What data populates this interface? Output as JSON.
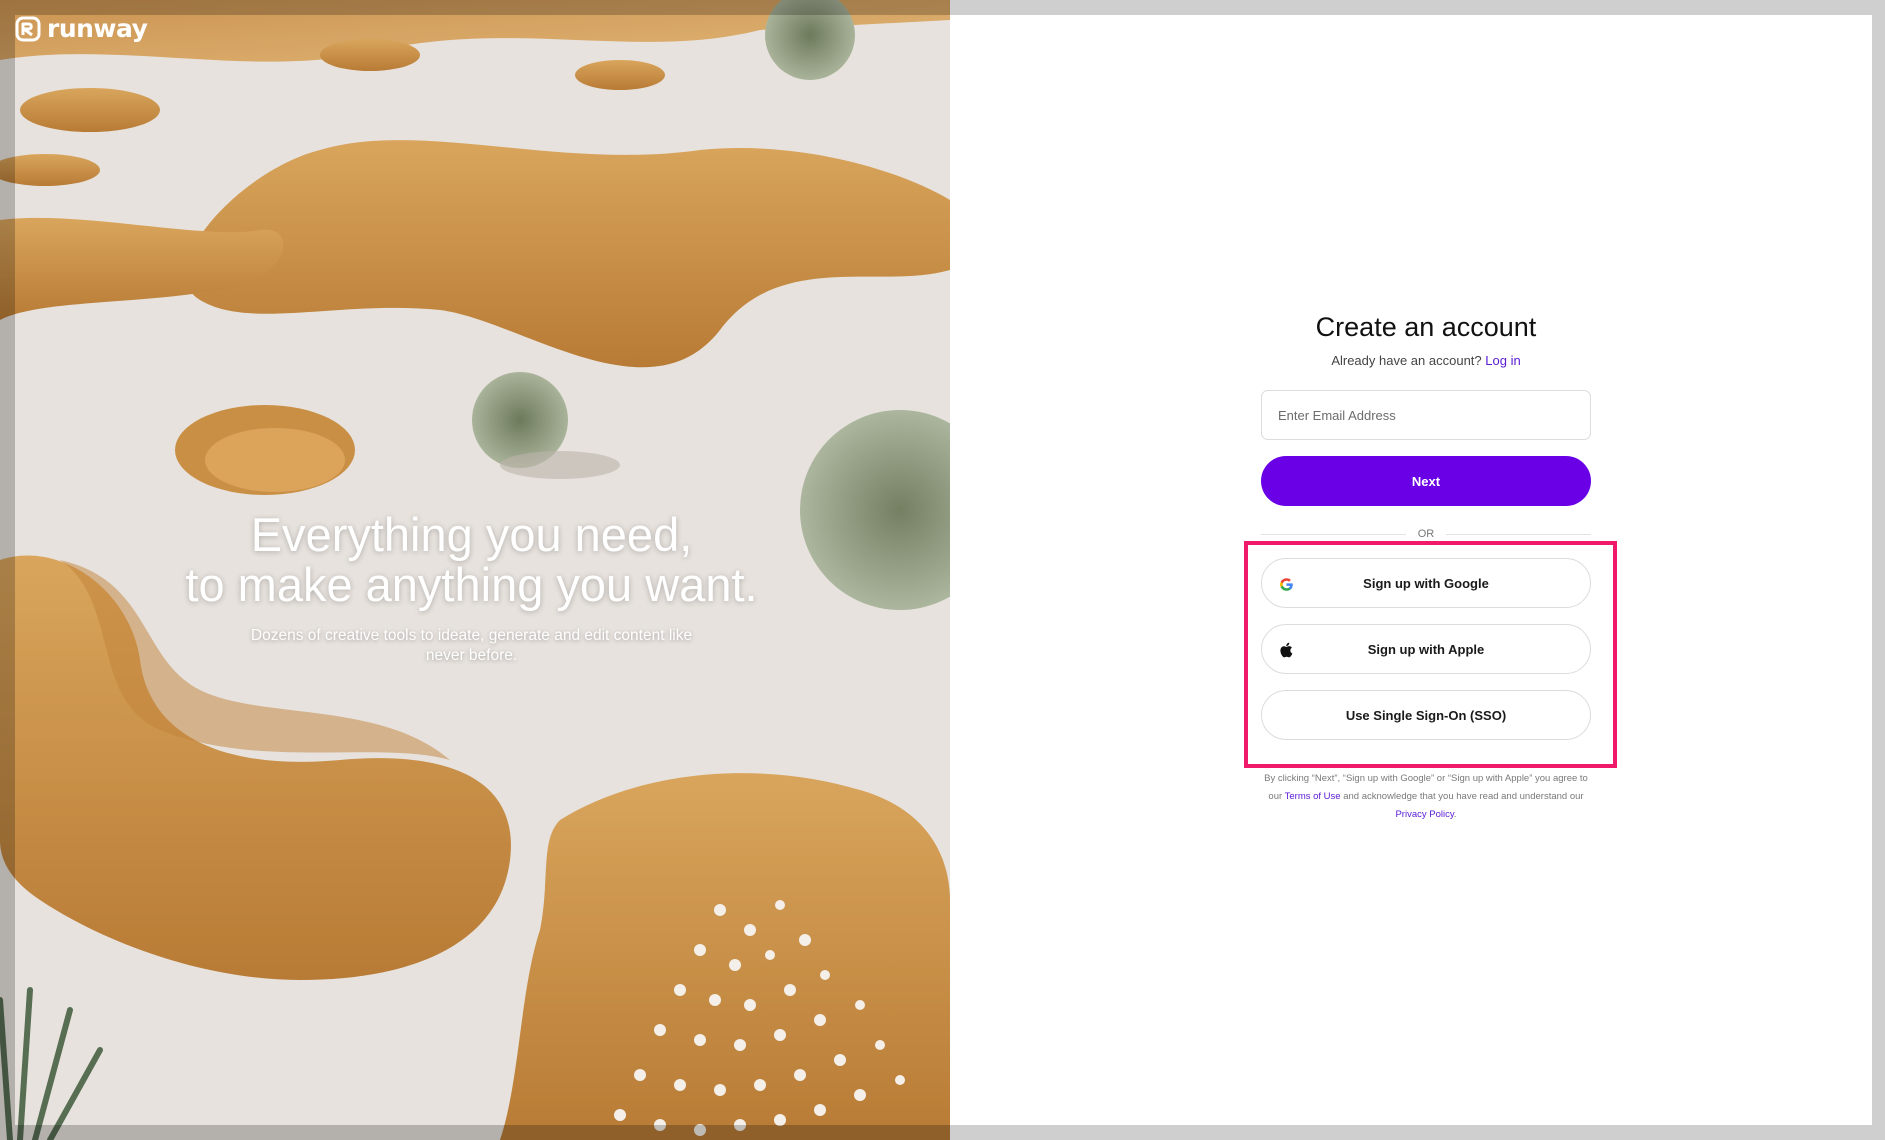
{
  "brand": {
    "name": "runway",
    "logo_icon": "runway-logo-icon"
  },
  "hero": {
    "headline_line1": "Everything you need,",
    "headline_line2": "to make anything you want.",
    "subtext": "Dozens of creative tools to ideate, generate and edit content like never before."
  },
  "form": {
    "title": "Create an account",
    "login_prompt": "Already have an account?",
    "login_link": "Log in",
    "email_placeholder": "Enter Email Address",
    "email_value": "",
    "next_label": "Next",
    "or_label": "OR",
    "google_label": "Sign up with Google",
    "google_icon": "google-icon",
    "apple_label": "Sign up with Apple",
    "apple_icon": "apple-icon",
    "sso_label": "Use Single Sign-On (SSO)"
  },
  "legal": {
    "text_before_terms": "By clicking “Next”, “Sign up with Google” or “Sign up with Apple” you agree to our",
    "terms_link": "Terms of Use",
    "text_middle": "and acknowledge that you have read and understand our",
    "privacy_link": "Privacy Policy",
    "text_end": "."
  },
  "colors": {
    "accent": "#6a00e6",
    "link": "#5a1ad6",
    "highlight": "#ef1a6a",
    "panel_bg": "#ffffff",
    "frame": "#cfcfcf"
  }
}
